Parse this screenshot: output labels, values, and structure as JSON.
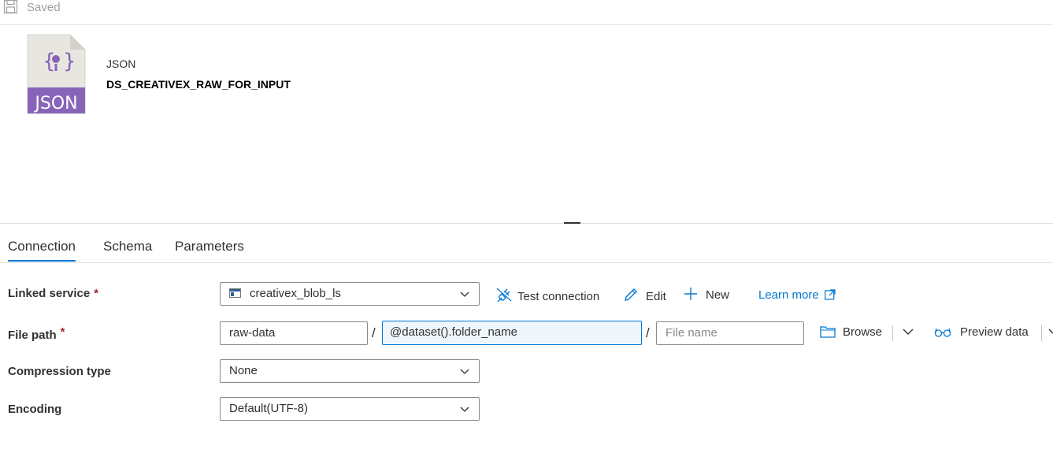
{
  "topbar": {
    "saved_label": "Saved",
    "save_icon": "save-icon"
  },
  "dataset": {
    "type_label": "JSON",
    "icon_text": "JSON",
    "name": "DS_CREATIVEX_RAW_FOR_INPUT",
    "icon_color": "#8764b8"
  },
  "tabs": [
    {
      "label": "Connection",
      "active": true
    },
    {
      "label": "Schema",
      "active": false
    },
    {
      "label": "Parameters",
      "active": false
    }
  ],
  "form": {
    "linked_service": {
      "label": "Linked service",
      "required_mark": "*",
      "value": "creativex_blob_ls",
      "actions": {
        "test_connection": "Test connection",
        "edit": "Edit",
        "new": "New",
        "learn_more": "Learn more"
      }
    },
    "file_path": {
      "label": "File path",
      "required_mark": "*",
      "container": "raw-data",
      "separator": "/",
      "directory": "@dataset().folder_name",
      "file_placeholder": "File name",
      "actions": {
        "browse": "Browse",
        "preview": "Preview data"
      }
    },
    "compression": {
      "label": "Compression type",
      "value": "None"
    },
    "encoding": {
      "label": "Encoding",
      "value": "Default(UTF-8)"
    }
  },
  "colors": {
    "accent": "#0078d4",
    "required": "#a4262c",
    "text": "#323130"
  }
}
